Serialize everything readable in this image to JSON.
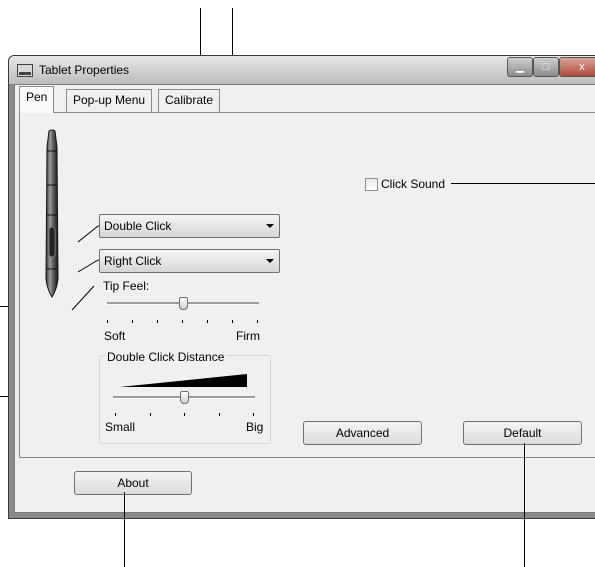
{
  "window": {
    "title": "Tablet Properties",
    "controls": {
      "minimize": "▁",
      "maximize": "□",
      "close": "x"
    }
  },
  "tabs": [
    {
      "label": "Pen",
      "active": true
    },
    {
      "label": "Pop-up Menu",
      "active": false
    },
    {
      "label": "Calibrate",
      "active": false
    }
  ],
  "pen_panel": {
    "upper_button": {
      "value": "Double Click"
    },
    "lower_button": {
      "value": "Right Click"
    },
    "tip_feel": {
      "label": "Tip Feel:",
      "min_label": "Soft",
      "max_label": "Firm",
      "level": 0.5
    },
    "double_click_distance": {
      "label": "Double Click Distance",
      "min_label": "Small",
      "max_label": "Big",
      "level": 0.5
    },
    "click_sound": {
      "label": "Click Sound",
      "checked": false
    },
    "advanced_label": "Advanced",
    "default_label": "Default"
  },
  "footer": {
    "about_label": "About"
  }
}
